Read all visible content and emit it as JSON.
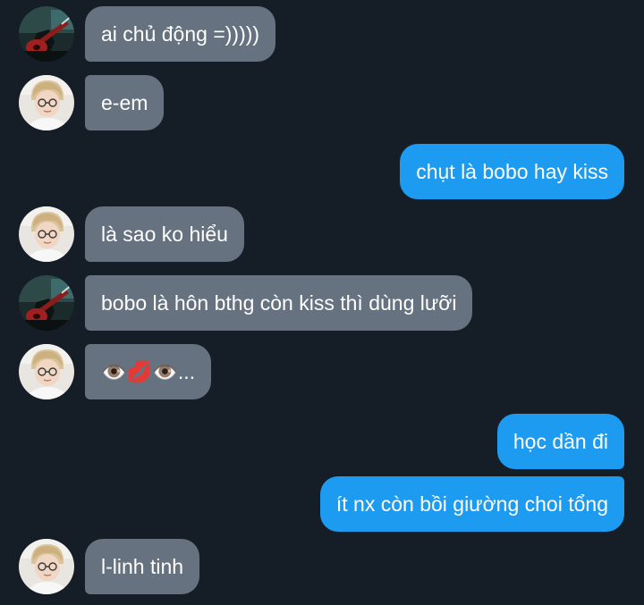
{
  "messages": [
    {
      "side": "in",
      "avatar": "guitar",
      "text": "ai chủ động =)))))"
    },
    {
      "side": "in",
      "avatar": "person",
      "text": "e-em"
    },
    {
      "side": "out",
      "text": "chụt là bobo hay kiss"
    },
    {
      "side": "in",
      "avatar": "person",
      "text": "là sao ko hiểu"
    },
    {
      "side": "in",
      "avatar": "guitar",
      "text": "bobo là hôn bthg còn kiss thì dùng lưỡi"
    },
    {
      "side": "in",
      "avatar": "person",
      "text": "👁️💋👁️..."
    },
    {
      "side": "out",
      "text": "học dần đi"
    },
    {
      "side": "out",
      "text": "ít nx còn bồi giường choi tổng"
    },
    {
      "side": "in",
      "avatar": "person",
      "text": "l-linh tinh"
    }
  ],
  "colors": {
    "background": "#151d27",
    "incoming_bubble": "#66727f",
    "outgoing_bubble": "#1d9bf0",
    "text": "#ffffff"
  }
}
